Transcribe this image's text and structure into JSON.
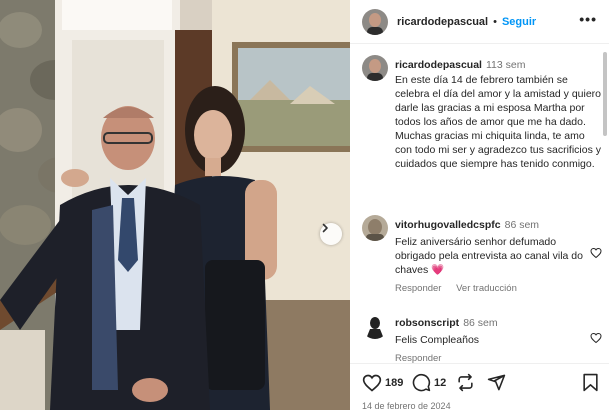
{
  "post": {
    "username": "ricardodepascual",
    "follow_label": "Seguir",
    "more_label": "•••",
    "date": "14 de febrero de 2024"
  },
  "caption": {
    "username": "ricardodepascual",
    "time_ago": "113 sem",
    "paragraph1": "En este día 14 de febrero también se celebra el día del amor y la amistad y quiero darle las gracias a mi esposa Martha por todos los años de amor que me ha dado.",
    "paragraph2": "Muchas gracias mi chiquita linda, te amo con todo mi ser y agradezco tus sacrificios y cuidados que siempre has tenido conmigo."
  },
  "comments": [
    {
      "username": "vitorhugovalledcspfc",
      "time_ago": "86 sem",
      "text": "Feliz aniversário senhor defumado obrigado pela entrevista ao canal vila do chaves",
      "emoji": "💗",
      "reply_label": "Responder",
      "translate_label": "Ver traducción"
    },
    {
      "username": "robsonscript",
      "time_ago": "86 sem",
      "text": "Felis Compleaños",
      "reply_label": "Responder"
    }
  ],
  "actions": {
    "likes": "189",
    "comments": "12",
    "icons": [
      "heart-icon",
      "comment-icon",
      "repost-icon",
      "share-icon",
      "bookmark-icon"
    ]
  },
  "colors": {
    "link": "#0095f6",
    "secondary_text": "#737373",
    "primary_text": "#262626",
    "heart_emoji": "#e8457a"
  }
}
